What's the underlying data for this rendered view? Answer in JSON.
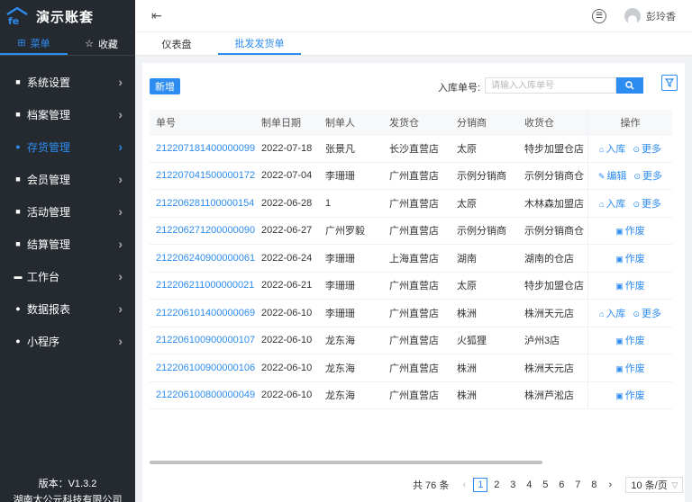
{
  "app": {
    "name": "演示账套"
  },
  "sidebar": {
    "tabs": [
      {
        "label": "菜单",
        "icon": "grid-icon"
      },
      {
        "label": "收藏",
        "icon": "star-icon"
      }
    ],
    "items": [
      {
        "label": "系统设置",
        "icon": "settings-icon"
      },
      {
        "label": "档案管理",
        "icon": "archive-icon"
      },
      {
        "label": "存货管理",
        "icon": "inventory-icon"
      },
      {
        "label": "会员管理",
        "icon": "member-icon"
      },
      {
        "label": "活动管理",
        "icon": "activity-icon"
      },
      {
        "label": "结算管理",
        "icon": "settlement-icon"
      },
      {
        "label": "工作台",
        "icon": "workbench-icon"
      },
      {
        "label": "数据报表",
        "icon": "report-icon"
      },
      {
        "label": "小程序",
        "icon": "miniapp-icon"
      }
    ],
    "active_index": 2,
    "footer": {
      "version": "版本：V1.3.2",
      "company": "湖南太公元科技有限公司"
    }
  },
  "header": {
    "username": "彭玲香"
  },
  "tabs": [
    {
      "label": "仪表盘"
    },
    {
      "label": "批发发货单"
    }
  ],
  "toolbar": {
    "add_label": "新增",
    "search_label": "入库单号:",
    "search_placeholder": "请输入入库单号",
    "search_value": ""
  },
  "table": {
    "columns": [
      "单号",
      "制单日期",
      "制单人",
      "发货仓",
      "分销商",
      "收货仓",
      "操作"
    ],
    "rows": [
      {
        "no": "212207181400000099",
        "date": "2022-07-18",
        "maker": "张景凡",
        "from": "长沙直营店",
        "dist": "太原",
        "to": "特步加盟仓店",
        "actions": [
          "入库",
          "更多"
        ]
      },
      {
        "no": "212207041500000172",
        "date": "2022-07-04",
        "maker": "李珊珊",
        "from": "广州直营店",
        "dist": "示例分销商",
        "to": "示例分销商仓",
        "actions": [
          "编辑",
          "更多"
        ]
      },
      {
        "no": "212206281100000154",
        "date": "2022-06-28",
        "maker": "1",
        "from": "广州直营店",
        "dist": "太原",
        "to": "木林森加盟店",
        "actions": [
          "入库",
          "更多"
        ]
      },
      {
        "no": "212206271200000090",
        "date": "2022-06-27",
        "maker": "广州罗毅",
        "from": "广州直营店",
        "dist": "示例分销商",
        "to": "示例分销商仓",
        "actions": [
          "作废"
        ]
      },
      {
        "no": "212206240900000061",
        "date": "2022-06-24",
        "maker": "李珊珊",
        "from": "上海直营店",
        "dist": "湖南",
        "to": "湖南的仓店",
        "actions": [
          "作废"
        ]
      },
      {
        "no": "212206211000000021",
        "date": "2022-06-21",
        "maker": "李珊珊",
        "from": "广州直营店",
        "dist": "太原",
        "to": "特步加盟仓店",
        "actions": [
          "作废"
        ]
      },
      {
        "no": "212206101400000069",
        "date": "2022-06-10",
        "maker": "李珊珊",
        "from": "广州直营店",
        "dist": "株洲",
        "to": "株洲天元店",
        "actions": [
          "入库",
          "更多"
        ]
      },
      {
        "no": "212206100900000107",
        "date": "2022-06-10",
        "maker": "龙东海",
        "from": "广州直营店",
        "dist": "火狐狸",
        "to": "泸州3店",
        "actions": [
          "作废"
        ]
      },
      {
        "no": "212206100900000106",
        "date": "2022-06-10",
        "maker": "龙东海",
        "from": "广州直营店",
        "dist": "株洲",
        "to": "株洲天元店",
        "actions": [
          "作废"
        ]
      },
      {
        "no": "212206100800000049",
        "date": "2022-06-10",
        "maker": "龙东海",
        "from": "广州直营店",
        "dist": "株洲",
        "to": "株洲芦淞店",
        "actions": [
          "作废"
        ]
      }
    ]
  },
  "pagination": {
    "total_text": "共 76 条",
    "pages": [
      "1",
      "2",
      "3",
      "4",
      "5",
      "6",
      "7",
      "8"
    ],
    "current": "1",
    "page_size": "10 条/页"
  },
  "colors": {
    "accent": "#2d8cf0",
    "sidebar_bg": "#252a30"
  }
}
